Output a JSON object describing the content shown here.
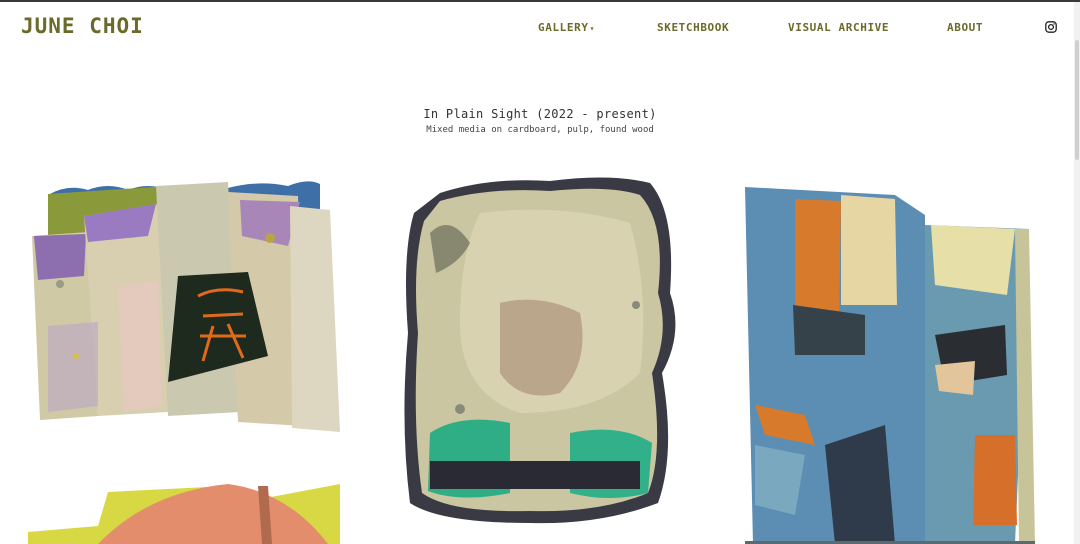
{
  "header": {
    "site_title": "JUNE CHOI",
    "nav": [
      {
        "label": "GALLERY",
        "has_dropdown": true
      },
      {
        "label": "SKETCHBOOK"
      },
      {
        "label": "VISUAL ARCHIVE"
      },
      {
        "label": "ABOUT"
      }
    ],
    "social_icon": "instagram-icon"
  },
  "main": {
    "series_title": "In Plain Sight (2022 - present)",
    "series_medium": "Mixed media on cardboard, pulp, found wood",
    "artworks": [
      {
        "name": "artwork-1"
      },
      {
        "name": "artwork-2"
      },
      {
        "name": "artwork-3"
      },
      {
        "name": "artwork-4"
      }
    ]
  },
  "colors": {
    "accent": "#6b6a2a",
    "text": "#333333",
    "background": "#ffffff"
  }
}
